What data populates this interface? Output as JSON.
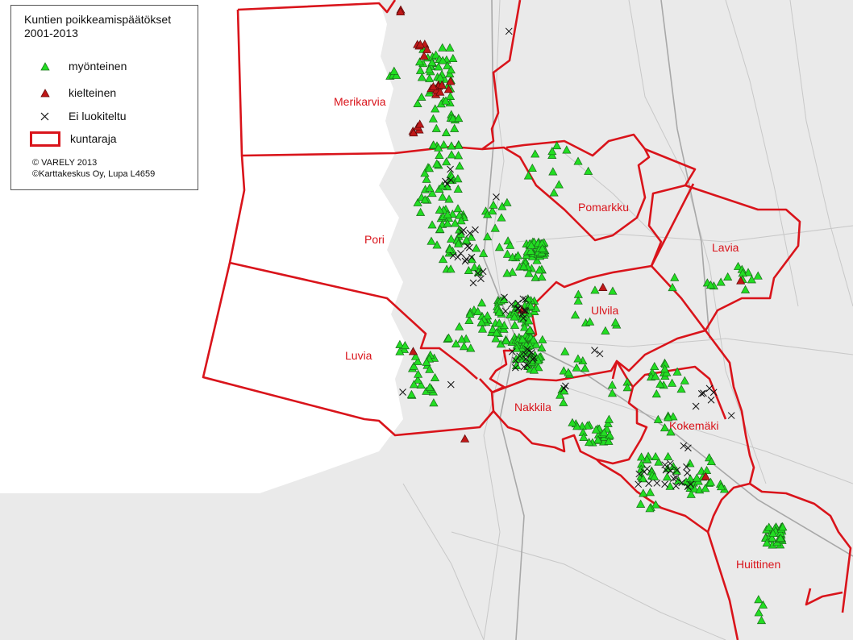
{
  "legend": {
    "title_line1": "Kuntien poikkeamispäätökset",
    "title_line2": "2001-2013",
    "items": [
      {
        "label": "myönteinen",
        "symbol": "green-triangle"
      },
      {
        "label": "kielteinen",
        "symbol": "red-triangle"
      },
      {
        "label": "Ei luokiteltu",
        "symbol": "black-cross"
      },
      {
        "label": "kuntaraja",
        "symbol": "red-outline-box"
      }
    ],
    "copyright_1": "© VARELY 2013",
    "copyright_2": "©Karttakeskus Oy, Lupa L4659"
  },
  "municipalities": [
    "Merikarvia",
    "Pori",
    "Luvia",
    "Pomarkku",
    "Lavia",
    "Ulvila",
    "Nakkila",
    "Kokemäki",
    "Huittinen"
  ],
  "colors": {
    "boundary": "#d9141b",
    "positive": "#22dd22",
    "negative": "#c01818",
    "unclassified": "#111111",
    "label": "#d9141b",
    "sea": "#ffffff",
    "land": "#e9e9e9"
  }
}
